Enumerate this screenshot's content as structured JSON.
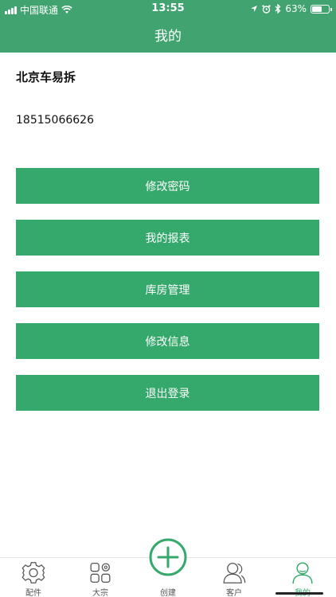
{
  "status_bar": {
    "carrier": "中国联通",
    "time": "13:55",
    "battery_percent": "63%",
    "battery_level": 0.63
  },
  "nav": {
    "title": "我的"
  },
  "profile": {
    "name": "北京车易拆",
    "phone": "18515066626"
  },
  "menu": [
    {
      "label": "修改密码"
    },
    {
      "label": "我的报表"
    },
    {
      "label": "库房管理"
    },
    {
      "label": "修改信息"
    },
    {
      "label": "退出登录"
    }
  ],
  "tabs": [
    {
      "label": "配件",
      "icon": "gear-icon"
    },
    {
      "label": "大宗",
      "icon": "grid-icon"
    },
    {
      "label": "创建",
      "icon": "plus-circle-icon"
    },
    {
      "label": "客户",
      "icon": "customers-icon"
    },
    {
      "label": "我的",
      "icon": "user-icon",
      "active": true
    }
  ],
  "colors": {
    "header": "#41a470",
    "button": "#35a96b",
    "active_tab": "#35a96b"
  }
}
